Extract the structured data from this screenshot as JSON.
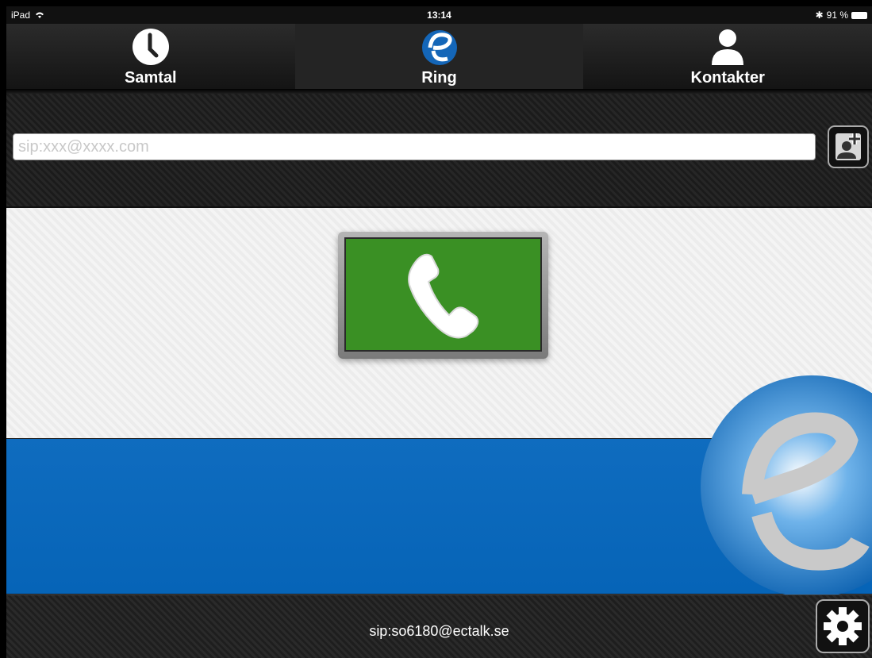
{
  "status_bar": {
    "device": "iPad",
    "time": "13:14",
    "battery": "91 %"
  },
  "tabs": [
    {
      "label": "Samtal",
      "icon": "clock-icon",
      "active": false
    },
    {
      "label": "Ring",
      "icon": "ectalk-logo-icon",
      "active": true
    },
    {
      "label": "Kontakter",
      "icon": "person-icon",
      "active": false
    }
  ],
  "dial": {
    "placeholder": "sip:xxx@xxxx.com",
    "value": ""
  },
  "buttons": {
    "add_contact_icon": "add-contact-icon",
    "call_icon": "phone-icon",
    "settings_icon": "gear-icon"
  },
  "footer": {
    "account": "sip:so6180@ectalk.se"
  },
  "colors": {
    "call_green": "#3a9024",
    "brand_blue": "#0a68bb"
  }
}
